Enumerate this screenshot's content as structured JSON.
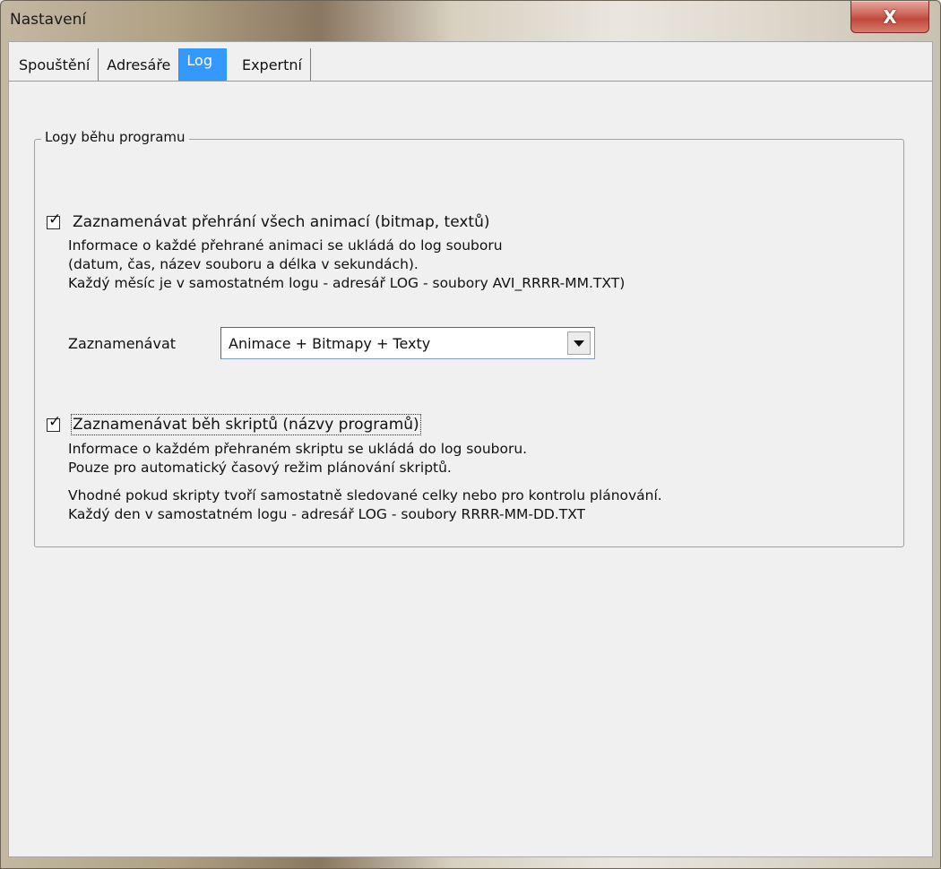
{
  "window": {
    "title": "Nastavení",
    "close_label": "X"
  },
  "tabs": [
    {
      "label": "Spouštění",
      "active": false
    },
    {
      "label": "Adresáře",
      "active": false
    },
    {
      "label": "Log",
      "active": true
    },
    {
      "label": "Expertní",
      "active": false
    }
  ],
  "group": {
    "label": "Logy běhu programu",
    "animations": {
      "checked": true,
      "label": "Zaznamenávat přehrání všech animací (bitmap, textů)",
      "lines": [
        "Informace o každé přehrané animaci se ukládá do log souboru",
        "(datum, čas, název souboru a délka v sekundách).",
        "Každý měsíc je v samostatném logu - adresář LOG - soubory AVI_RRRR-MM.TXT)"
      ],
      "combo_label": "Zaznamenávat",
      "combo_value": "Animace + Bitmapy + Texty"
    },
    "scripts": {
      "checked": true,
      "label": "Zaznamenávat běh skriptů (názvy programů)",
      "lines": [
        "Informace o každém přehraném skriptu se ukládá do log souboru.",
        "Pouze pro automatický časový režim plánování skriptů."
      ],
      "lines2": [
        "Vhodné pokud skripty tvoří samostatně sledované celky nebo pro kontrolu plánování.",
        "Každý den v samostatném logu - adresář LOG - soubory RRRR-MM-DD.TXT"
      ]
    }
  },
  "colors": {
    "active_tab": "#3399ff",
    "close_button": "#c1473c",
    "dialog_background": "#f0f0f0"
  }
}
